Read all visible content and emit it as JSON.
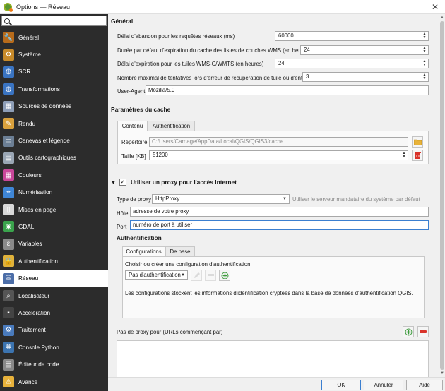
{
  "window": {
    "title": "Options — Réseau"
  },
  "sidebar": {
    "search_placeholder": "",
    "items": [
      {
        "label": "Général",
        "icon": "wrench-icon",
        "color": "#b76b1b"
      },
      {
        "label": "Système",
        "icon": "gears-icon",
        "color": "#c78a2a"
      },
      {
        "label": "SCR",
        "icon": "globe-icon",
        "color": "#3a74c2"
      },
      {
        "label": "Transformations",
        "icon": "globe-transform-icon",
        "color": "#3a74c2"
      },
      {
        "label": "Sources de données",
        "icon": "table-icon",
        "color": "#8e9eb7"
      },
      {
        "label": "Rendu",
        "icon": "paintbrush-icon",
        "color": "#d9a13d"
      },
      {
        "label": "Canevas et légende",
        "icon": "canvas-icon",
        "color": "#6c7f95"
      },
      {
        "label": "Outils cartographiques",
        "icon": "map-tools-icon",
        "color": "#9aa6b4"
      },
      {
        "label": "Couleurs",
        "icon": "colors-icon",
        "color": "#c9479a"
      },
      {
        "label": "Numérisation",
        "icon": "digitizing-icon",
        "color": "#3f86d6"
      },
      {
        "label": "Mises en page",
        "icon": "layout-icon",
        "color": "#d8d8d8"
      },
      {
        "label": "GDAL",
        "icon": "gdal-icon",
        "color": "#3aa34c"
      },
      {
        "label": "Variables",
        "icon": "variables-icon",
        "color": "#8a8a8a"
      },
      {
        "label": "Authentification",
        "icon": "lock-icon",
        "color": "#e0b23a"
      },
      {
        "label": "Réseau",
        "icon": "network-icon",
        "color": "#4c6ea8"
      },
      {
        "label": "Localisateur",
        "icon": "magnifier-icon",
        "color": "#555555"
      },
      {
        "label": "Accélération",
        "icon": "acceleration-icon",
        "color": "#444444"
      },
      {
        "label": "Traitement",
        "icon": "gear-icon",
        "color": "#4a7bbd"
      },
      {
        "label": "Console Python",
        "icon": "python-icon",
        "color": "#3c74b0"
      },
      {
        "label": "Éditeur de code",
        "icon": "code-editor-icon",
        "color": "#888888"
      },
      {
        "label": "Avancé",
        "icon": "warning-icon",
        "color": "#e8b23b"
      }
    ]
  },
  "general": {
    "title": "Général",
    "timeout_label": "Délai d'abandon pour les requêtes réseaux (ms)",
    "timeout_value": "60000",
    "wms_cache_label": "Durée par défaut d'expiration du cache des listes de couches WMS (en heures)",
    "wms_cache_value": "24",
    "wmts_label": "Délai d'expiration pour les tuiles WMS-C/WMTS (en heures)",
    "wmts_value": "24",
    "retries_label": "Nombre maximal de tentatives lors d'erreur de récupération de tuile ou d'entités",
    "retries_value": "3",
    "useragent_label": "User-Agent",
    "useragent_value": "Mozilla/5.0"
  },
  "cache": {
    "title": "Paramètres du cache",
    "tab_content": "Contenu",
    "tab_auth": "Authentification",
    "dir_label": "Répertoire",
    "dir_value": "C:/Users/Carnage/AppData/Local/QGIS/QGIS3/cache",
    "size_label": "Taille [KB]",
    "size_value": "51200"
  },
  "proxy": {
    "title": "Utiliser un proxy pour l'accès Internet",
    "checked": "✓",
    "type_label": "Type de proxy",
    "type_value": "HttpProxy",
    "system_note": "Utiliser le serveur mandataire du système par défaut",
    "host_label": "Hôte",
    "host_value": "adresse de votre proxy",
    "port_label": "Port",
    "port_value": "numéro de port à utiliser",
    "auth_title": "Authentification",
    "tab_configs": "Configurations",
    "tab_basic": "De base",
    "choose_label": "Choisir ou créer une configuration d'authentification",
    "no_auth": "Pas d'authentification",
    "info_text": "Les configurations stockent les informations d'identification cryptées dans la base de données d'authentification QGIS.",
    "excluded_label": "Pas de proxy pour (URLs commençant par)"
  },
  "footer": {
    "ok": "OK",
    "cancel": "Annuler",
    "help": "Aide"
  }
}
